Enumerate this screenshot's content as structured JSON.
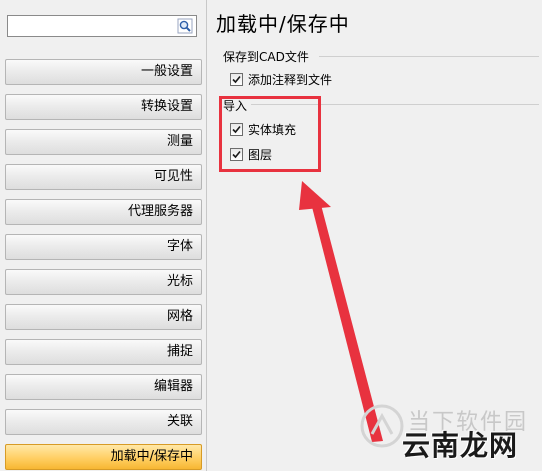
{
  "sidebar": {
    "search_value": "",
    "items": [
      {
        "label": "一般设置",
        "active": false
      },
      {
        "label": "转换设置",
        "active": false
      },
      {
        "label": "测量",
        "active": false
      },
      {
        "label": "可见性",
        "active": false
      },
      {
        "label": "代理服务器",
        "active": false
      },
      {
        "label": "字体",
        "active": false
      },
      {
        "label": "光标",
        "active": false
      },
      {
        "label": "网格",
        "active": false
      },
      {
        "label": "捕捉",
        "active": false
      },
      {
        "label": "编辑器",
        "active": false
      },
      {
        "label": "关联",
        "active": false
      },
      {
        "label": "加载中/保存中",
        "active": true
      }
    ]
  },
  "main": {
    "title": "加载中/保存中",
    "save_group": {
      "title": "保存到CAD文件",
      "options": [
        {
          "label": "添加注释到文件",
          "checked": true
        }
      ]
    },
    "import_group": {
      "title": "导入",
      "options": [
        {
          "label": "实体填充",
          "checked": true
        },
        {
          "label": "图层",
          "checked": true
        }
      ]
    }
  },
  "watermark": {
    "top": "当下软件园",
    "bottom": "云南龙网"
  },
  "colors": {
    "active_tab": "#ffcf64",
    "annotation": "#e8323f"
  }
}
